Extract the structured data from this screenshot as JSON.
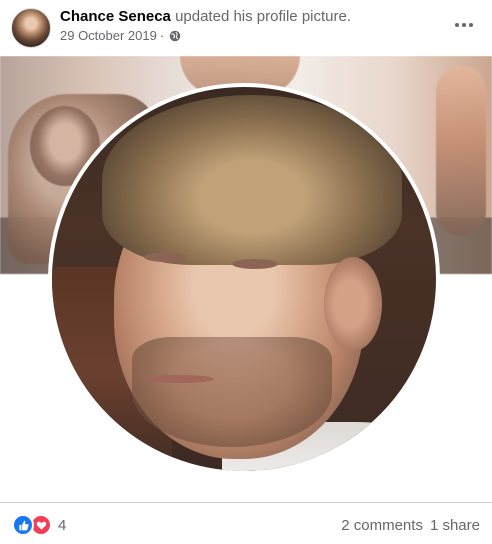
{
  "post": {
    "author": "Chance Seneca",
    "action": "updated his profile picture.",
    "date": "29 October 2019",
    "separator": "·",
    "privacy_icon": "globe-icon",
    "more_icon": "more-horizontal-icon"
  },
  "media": {
    "cover_icon": "cover-photo",
    "profile_icon": "profile-picture"
  },
  "footer": {
    "reaction_icons": [
      "like-reaction-icon",
      "love-reaction-icon"
    ],
    "reaction_count": "4",
    "comments": "2 comments",
    "shares": "1 share"
  },
  "colors": {
    "like": "#1877f2",
    "love": "#f33e58",
    "secondary_text": "#65676b",
    "divider": "#ced0d4"
  }
}
